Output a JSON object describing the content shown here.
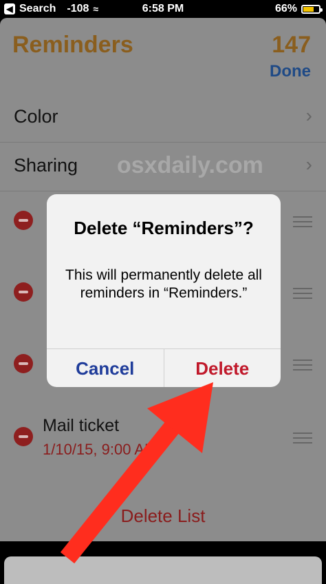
{
  "status_bar": {
    "back_label": "Search",
    "signal": "-108",
    "time": "6:58 PM",
    "battery": "66%",
    "battery_fraction": 0.66
  },
  "header": {
    "title": "Reminders",
    "count": "147",
    "done_label": "Done"
  },
  "settings": [
    {
      "label": "Color"
    },
    {
      "label": "Sharing"
    }
  ],
  "watermark": "osxdaily.com",
  "items": [
    {
      "title": "",
      "date": ""
    },
    {
      "title": "",
      "date": ""
    },
    {
      "title": "",
      "date": ""
    },
    {
      "title": "Mail ticket",
      "date": "1/10/15, 9:00 AM"
    }
  ],
  "footer": {
    "delete_list_label": "Delete List"
  },
  "alert": {
    "title": "Delete “Reminders”?",
    "message": "This will permanently delete all reminders in “Reminders.”",
    "cancel_label": "Cancel",
    "delete_label": "Delete"
  },
  "colors": {
    "accent_orange": "#8a5e1e",
    "accent_blue": "#1f4a86",
    "destructive_red": "#c0182a",
    "arrow_red": "#ff2d1e"
  }
}
